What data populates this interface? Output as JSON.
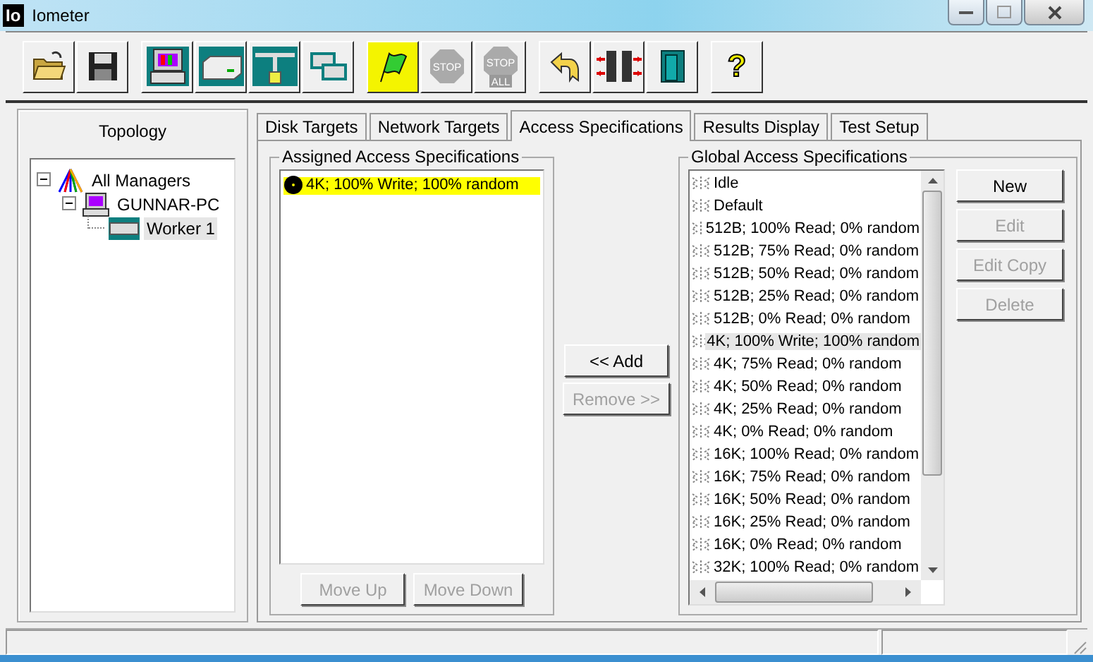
{
  "window": {
    "logo": "Io",
    "title": "Iometer"
  },
  "toolbar": [
    [
      {
        "kind": "open"
      },
      {
        "kind": "save"
      }
    ],
    [
      {
        "kind": "computer"
      },
      {
        "kind": "disk"
      },
      {
        "kind": "network"
      },
      {
        "kind": "windows"
      }
    ],
    [
      {
        "kind": "start",
        "highlighted": true,
        "disabled": false
      },
      {
        "kind": "stop",
        "label": "STOP",
        "disabled": true
      },
      {
        "kind": "stopall",
        "label": "STOP",
        "label2": "ALL",
        "disabled": true
      }
    ],
    [
      {
        "kind": "reset"
      },
      {
        "kind": "arrows"
      },
      {
        "kind": "exit"
      }
    ],
    [
      {
        "kind": "help",
        "label": "?"
      }
    ]
  ],
  "topology": {
    "title": "Topology",
    "tree": [
      {
        "kind": "managers",
        "label": "All Managers",
        "expanded": true,
        "selected": false,
        "children": [
          {
            "kind": "computer",
            "label": "GUNNAR-PC",
            "expanded": true,
            "selected": false,
            "children": [
              {
                "kind": "worker",
                "label": "Worker 1",
                "selected": true
              }
            ]
          }
        ]
      }
    ]
  },
  "tabs": [
    {
      "label": "Disk Targets",
      "selected": false
    },
    {
      "label": "Network Targets",
      "selected": false
    },
    {
      "label": "Access Specifications",
      "selected": true
    },
    {
      "label": "Results Display",
      "selected": false
    },
    {
      "label": "Test Setup",
      "selected": false
    }
  ],
  "assigned": {
    "title": "Assigned Access Specifications",
    "items": [
      {
        "label": "4K; 100% Write; 100% random",
        "highlighted": true
      }
    ],
    "buttons": [
      {
        "label": "Move Up",
        "disabled": true
      },
      {
        "label": "Move Down",
        "disabled": true
      }
    ]
  },
  "transfer_buttons": [
    {
      "label": "<< Add",
      "disabled": false
    },
    {
      "label": "Remove >>",
      "disabled": true
    }
  ],
  "global": {
    "title": "Global Access Specifications",
    "items": [
      {
        "label": "Idle",
        "selected": false
      },
      {
        "label": "Default",
        "selected": false
      },
      {
        "label": "512B; 100% Read; 0% random",
        "selected": false
      },
      {
        "label": "512B; 75% Read; 0% random",
        "selected": false
      },
      {
        "label": "512B; 50% Read; 0% random",
        "selected": false
      },
      {
        "label": "512B; 25% Read; 0% random",
        "selected": false
      },
      {
        "label": "512B; 0% Read; 0% random",
        "selected": false
      },
      {
        "label": "4K; 100% Write; 100% random",
        "selected": true
      },
      {
        "label": "4K; 75% Read; 0% random",
        "selected": false
      },
      {
        "label": "4K; 50% Read; 0% random",
        "selected": false
      },
      {
        "label": "4K; 25% Read; 0% random",
        "selected": false
      },
      {
        "label": "4K; 0% Read; 0% random",
        "selected": false
      },
      {
        "label": "16K; 100% Read; 0% random",
        "selected": false
      },
      {
        "label": "16K; 75% Read; 0% random",
        "selected": false
      },
      {
        "label": "16K; 50% Read; 0% random",
        "selected": false
      },
      {
        "label": "16K; 25% Read; 0% random",
        "selected": false
      },
      {
        "label": "16K; 0% Read; 0% random",
        "selected": false
      },
      {
        "label": "32K; 100% Read; 0% random",
        "selected": false
      }
    ],
    "buttons": [
      {
        "label": "New",
        "disabled": false
      },
      {
        "label": "Edit",
        "disabled": true
      },
      {
        "label": "Edit Copy",
        "disabled": true
      },
      {
        "label": "Delete",
        "disabled": true
      }
    ]
  }
}
